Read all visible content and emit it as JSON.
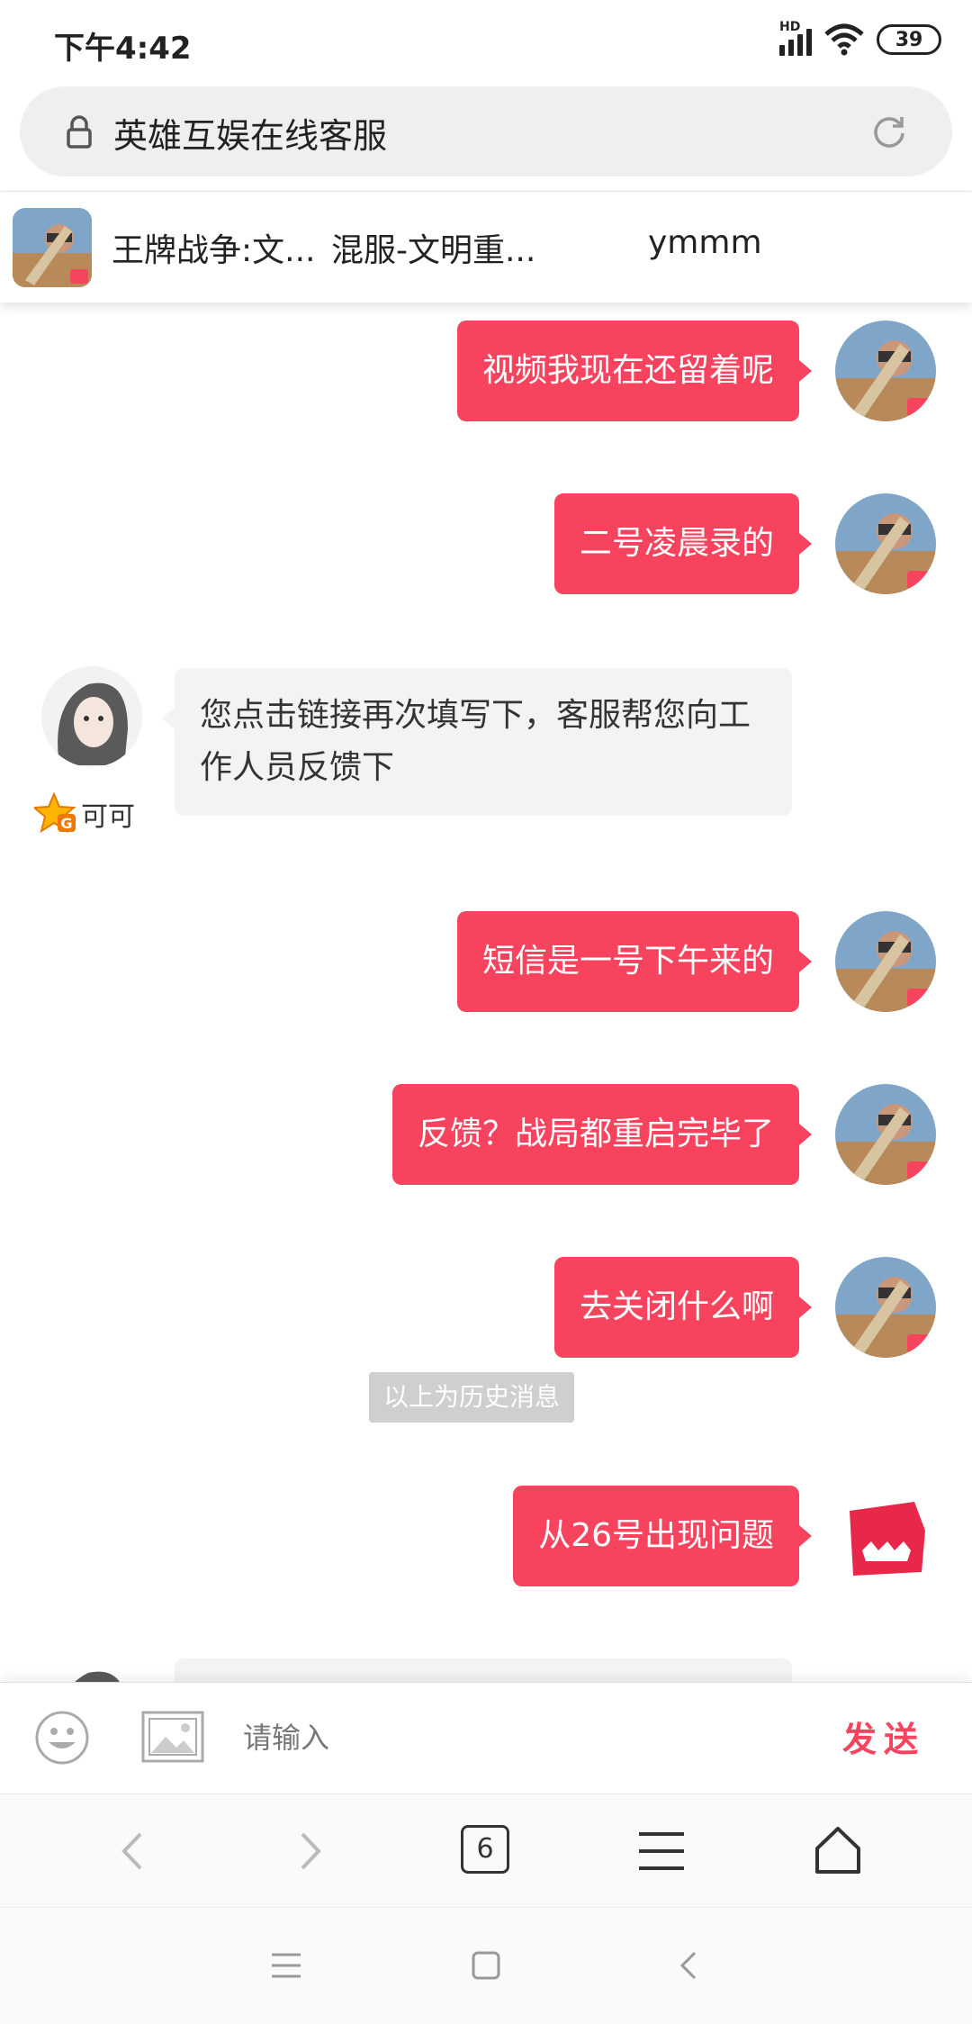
{
  "status_bar": {
    "time": "下午4:42",
    "hd_label": "HD",
    "battery": "39"
  },
  "address_bar": {
    "title": "英雄互娱在线客服"
  },
  "game_header": {
    "game_name": "王牌战争:文...",
    "server_name": "混服-文明重...",
    "player_name": "ymmm"
  },
  "messages": [
    {
      "text": "视频我现在还留着呢"
    },
    {
      "text": "二号凌晨录的"
    },
    {
      "text": "您点击链接再次填写下，客服帮您向工作人员反馈下"
    },
    {
      "text": "短信是一号下午来的"
    },
    {
      "text": "反馈？战局都重启完毕了"
    },
    {
      "text": "去关闭什么啊"
    },
    {
      "text": "从26号出现问题"
    }
  ],
  "agent": {
    "name": "可可",
    "badge": "G"
  },
  "history_label": "以上为历史消息",
  "input_bar": {
    "placeholder": "请输入",
    "send_label": "发送"
  },
  "browser_toolbar": {
    "tab_count": "6"
  },
  "colors": {
    "accent": "#f7435e",
    "incoming_bg": "#f3f3f4"
  },
  "icons": [
    "lock-icon",
    "refresh-icon",
    "emoji-icon",
    "image-icon",
    "back-icon",
    "forward-icon",
    "menu-icon",
    "home-icon"
  ]
}
